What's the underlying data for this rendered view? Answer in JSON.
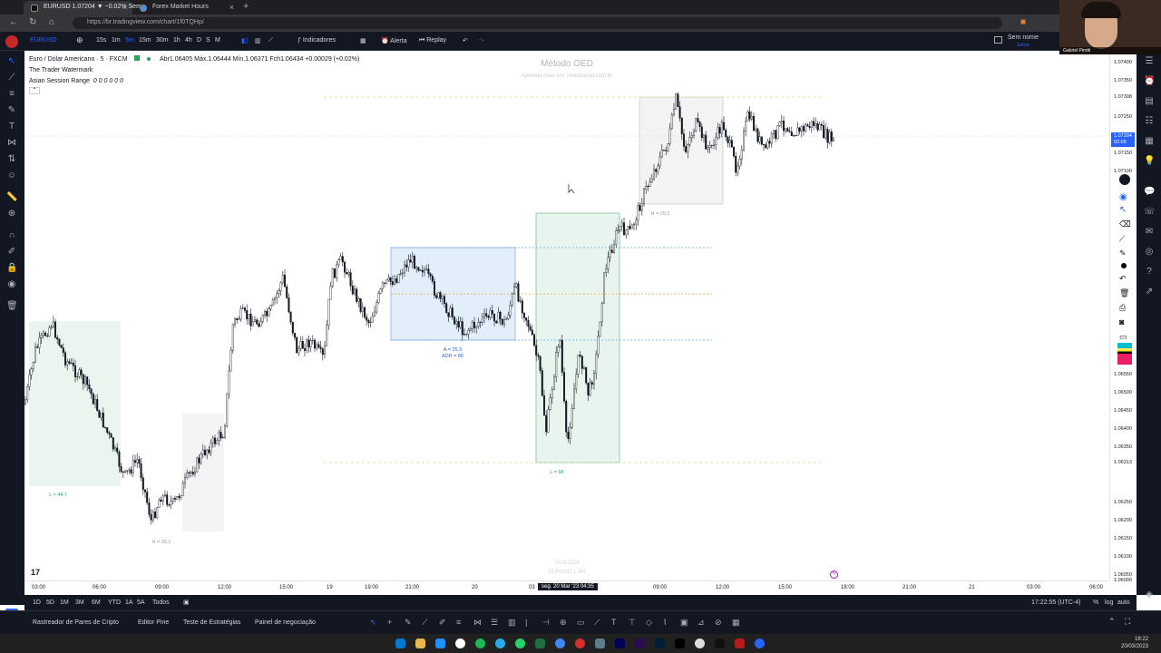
{
  "browser": {
    "tabs": [
      {
        "title": "EURUSD 1.07204 ▼ −0.02% Sem",
        "active": true
      },
      {
        "title": "Forex Market Hours",
        "active": false
      }
    ],
    "url": "https://br.tradingview.com/chart/1f0TQHp/"
  },
  "toolbar": {
    "symbol": "EURUSD",
    "intervals": [
      "15s",
      "1m",
      "5m",
      "15m",
      "30m",
      "1h",
      "4h",
      "D",
      "S",
      "M"
    ],
    "indicators_label": "Indicadores",
    "alert_label": "Alerta",
    "replay_label": "Replay",
    "layout_name": "Sem nome",
    "layout_sub": "Salvar"
  },
  "legend": {
    "title": "Euro / Dólar Americano · 5 · FXCM",
    "ohlc": "Abr1.06405  Máx.1.06444  Mín.1.06371  Fch1.06434  +0.00029 (+0.02%)",
    "ind1": "The Trader Watermark",
    "ind2": "Asian Session Range",
    "ind2_values": "0 0 0 0 0 0"
  },
  "watermark": {
    "title": "Método OED",
    "subtitle": "Aprenda mais em: metodooed.com.br",
    "date": "20/3/2023",
    "symbol": "EURUSD 1.5M"
  },
  "annotations": {
    "a1": "A = 25.3",
    "adr": "ADR = 86",
    "l1": "L = 68",
    "h1": "H = 29.2",
    "l2": "L = 44.7",
    "h2": "H = 36.1"
  },
  "price_axis": {
    "labels": [
      "1.07400",
      "1.07350",
      "1.07308",
      "1.07250",
      "1.07150",
      "1.07100",
      "1.06550",
      "1.06500",
      "1.06450",
      "1.06400",
      "1.06350",
      "1.06313",
      "1.06250",
      "1.06200",
      "1.06150",
      "1.06100",
      "1.06050",
      "1.06000"
    ],
    "current_price": "1.07204",
    "current_time": "02:05"
  },
  "time_axis": {
    "labels": [
      "03:00",
      "06:00",
      "09:00",
      "12:00",
      "15:00",
      "19",
      "19:00",
      "21:00",
      "20",
      "03",
      "09:00",
      "12:00",
      "15:00",
      "18:00",
      "21:00",
      "21",
      "03:00",
      "06:00"
    ],
    "crosshair": "seg. 20 Mar '23  04:35"
  },
  "range_bar": {
    "ranges": [
      "1D",
      "5D",
      "1M",
      "3M",
      "6M",
      "YTD",
      "1A",
      "5A",
      "Todos"
    ],
    "clock": "17:22:55 (UTC-4)",
    "pct": "%",
    "log": "log",
    "auto": "auto"
  },
  "bottom_panel": {
    "tabs": [
      "Rastreador de Pares de Cripto",
      "Editor Pine",
      "Teste de Estratégias",
      "Painel de negociação"
    ]
  },
  "taskbar": {
    "time": "18:22",
    "date": "20/03/2023"
  },
  "webcam": {
    "name": "Gabriel Pirotti"
  },
  "colors": {
    "accent": "#2962ff",
    "chart_bg": "#ffffff",
    "dark": "#131722",
    "blue_box": "#e3eefb",
    "green_box": "#e8f5ee",
    "gray_box": "#f3f3f3"
  }
}
